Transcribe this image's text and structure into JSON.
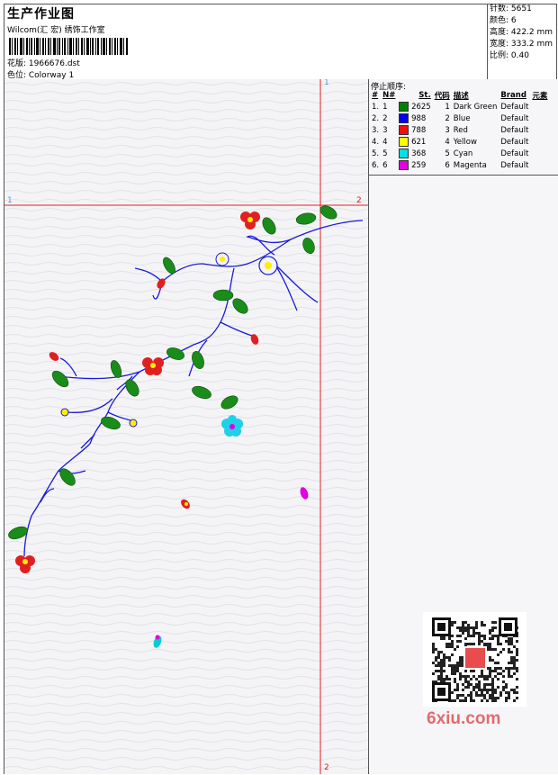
{
  "header": {
    "title": "生产作业图",
    "company": "Wilcom(汇 宏) 绣饰工作室",
    "design_file": "花版:  1966676.dst",
    "colorway": "色位:  Colorway 1"
  },
  "stats": [
    "针数: 5651",
    "颜色: 6",
    "高度: 422.2 mm",
    "宽度: 333.2 mm",
    "比例: 0.40"
  ],
  "stop_sequence": {
    "title": "停止顺序:",
    "headers": [
      "#",
      "N#",
      "St.",
      "代码",
      "描述",
      "Brand",
      "元素"
    ],
    "rows": [
      {
        "idx": "1.",
        "n": "1",
        "color": "#008000",
        "stitches": "2625",
        "code": "1",
        "desc": "Dark Green",
        "brand": "Default"
      },
      {
        "idx": "2.",
        "n": "2",
        "color": "#0000ee",
        "stitches": "988",
        "code": "2",
        "desc": "Blue",
        "brand": "Default"
      },
      {
        "idx": "3.",
        "n": "3",
        "color": "#ee1010",
        "stitches": "788",
        "code": "3",
        "desc": "Red",
        "brand": "Default"
      },
      {
        "idx": "4.",
        "n": "4",
        "color": "#ffff00",
        "stitches": "621",
        "code": "4",
        "desc": "Yellow",
        "brand": "Default"
      },
      {
        "idx": "5.",
        "n": "5",
        "color": "#00e0e0",
        "stitches": "368",
        "code": "5",
        "desc": "Cyan",
        "brand": "Default"
      },
      {
        "idx": "6.",
        "n": "6",
        "color": "#e000e0",
        "stitches": "259",
        "code": "6",
        "desc": "Magenta",
        "brand": "Default"
      }
    ]
  },
  "guides": {
    "label_1": "1",
    "label_2": "2"
  },
  "watermark": "6xiu.com"
}
